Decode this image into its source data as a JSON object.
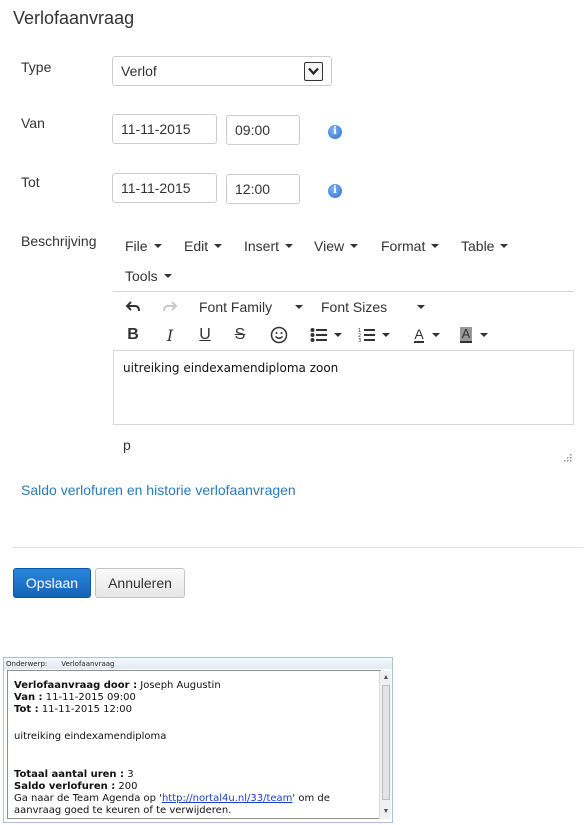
{
  "dialog": {
    "title": "Verlofaanvraag",
    "type": {
      "label": "Type",
      "value": "Verlof"
    },
    "van": {
      "label": "Van",
      "date": "11-11-2015",
      "time": "09:00"
    },
    "tot": {
      "label": "Tot",
      "date": "11-11-2015",
      "time": "12:00"
    },
    "beschrijving": {
      "label": "Beschrijving"
    },
    "editor": {
      "menu": [
        "File",
        "Edit",
        "Insert",
        "View",
        "Format",
        "Table",
        "Tools"
      ],
      "font_family": "Font Family",
      "font_sizes": "Font Sizes",
      "content": "uitreiking eindexamendiploma zoon",
      "status_path": "p"
    },
    "saldo_link": "Saldo verlofuren en historie verlofaanvragen",
    "save_label": "Opslaan",
    "cancel_label": "Annuleren"
  },
  "email": {
    "subject_label": "Onderwerp:",
    "subject_value": "Verlofaanvraag",
    "door_label": "Verlofaanvraag door :",
    "door_value": "Joseph Augustin",
    "van_label": "Van :",
    "van_value": "11-11-2015 09:00",
    "tot_label": "Tot :",
    "tot_value": "11-11-2015 12:00",
    "description": "uitreiking eindexamendiploma",
    "uren_label": "Totaal aantal uren :",
    "uren_value": "3",
    "saldo_label": "Saldo verlofuren :",
    "saldo_value": "200",
    "footer_prefix": "Ga naar de Team Agenda op '",
    "footer_link": "http://nortal4u.nl/33/team",
    "footer_line1_suffix": "' om de",
    "footer_line2": "aanvraag goed te keuren of te verwijderen."
  },
  "colors": {
    "primary_button": "#1a6fc9",
    "link": "#2a7ab8",
    "info_icon": "#2f6fd0"
  },
  "icons": [
    "chevron-down-icon",
    "info-icon",
    "undo-icon",
    "redo-icon",
    "bold-icon",
    "italic-icon",
    "underline-icon",
    "strikethrough-icon",
    "emoticon-icon",
    "bullet-list-icon",
    "numbered-list-icon",
    "text-color-icon",
    "background-color-icon",
    "resize-handle-icon"
  ]
}
